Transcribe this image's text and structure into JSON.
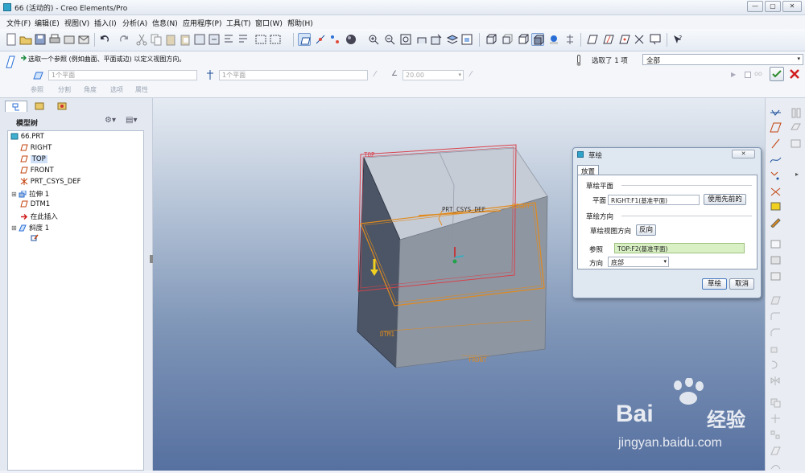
{
  "window": {
    "title": "66 (活动的) - Creo Elements/Pro"
  },
  "menubar": [
    "文件(F)",
    "编辑(E)",
    "视图(V)",
    "插入(I)",
    "分析(A)",
    "信息(N)",
    "应用程序(P)",
    "工具(T)",
    "窗口(W)",
    "帮助(H)"
  ],
  "dashboard": {
    "message": "选取一个参照 (例如曲面、平面或边) 以定义视图方向。",
    "field1_placeholder": "1个平面",
    "field2_placeholder": "1个平面",
    "angle_value": "20.00",
    "tabs": [
      "参照",
      "分割",
      "角度",
      "选项",
      "属性"
    ],
    "selection_status": "选取了 1 项",
    "filter_value": "全部"
  },
  "model_tree": {
    "header": "模型树",
    "items": [
      "66.PRT",
      "RIGHT",
      "TOP",
      "FRONT",
      "PRT_CSYS_DEF",
      "拉伸 1",
      "DTM1",
      "在此插入",
      "斜度 1"
    ]
  },
  "viewport_labels": {
    "top": "TOP",
    "csys": "PRT_CSYS_DEF",
    "right": "RIGHT",
    "dtm1": "DTM1",
    "front": "FRONT"
  },
  "sketch_dialog": {
    "title": "草绘",
    "tab": "放置",
    "section_plane": "草绘平面",
    "plane_label": "平面",
    "plane_value": "RIGHT:F1(基准平面)",
    "use_previous": "使用先前的",
    "section_orientation": "草绘方向",
    "view_dir_label": "草绘视图方向",
    "flip_button": "反向",
    "reference_label": "参照",
    "reference_value": "TOP:F2(基准平面)",
    "orientation_label": "方向",
    "orientation_value": "底部",
    "ok_button": "草绘",
    "cancel_button": "取消"
  },
  "watermark": {
    "brand": "Bai",
    "brand2": "经验",
    "url": "jingyan.baidu.com"
  },
  "colors": {
    "accent": "#2b6fd6",
    "viewport_bottom": "#5670a0",
    "datum_orange": "#e08a1e",
    "datum_red": "#d9414a",
    "ref_field": "#d8f0c4"
  }
}
